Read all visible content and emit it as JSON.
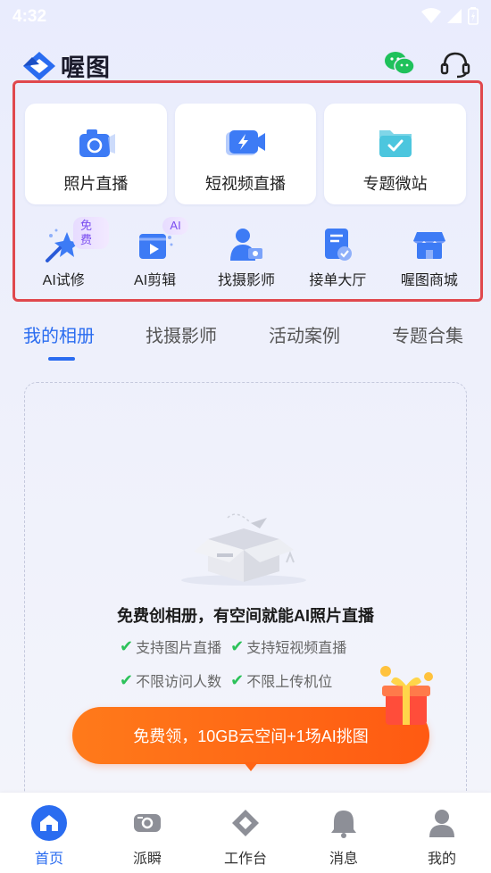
{
  "status_bar": {
    "time": "4:32"
  },
  "header": {
    "logo_text": "喔图"
  },
  "feature_cards": [
    {
      "label": "照片直播",
      "icon": "camera-icon"
    },
    {
      "label": "短视频直播",
      "icon": "video-camera-icon"
    },
    {
      "label": "专题微站",
      "icon": "folder-check-icon"
    }
  ],
  "tools": [
    {
      "label": "AI试修",
      "icon": "magic-star-icon",
      "badge": "免费"
    },
    {
      "label": "AI剪辑",
      "icon": "video-edit-icon",
      "badge": "AI"
    },
    {
      "label": "找摄影师",
      "icon": "photographer-icon",
      "badge": ""
    },
    {
      "label": "接单大厅",
      "icon": "order-document-icon",
      "badge": ""
    },
    {
      "label": "喔图商城",
      "icon": "store-icon",
      "badge": ""
    }
  ],
  "tabs": [
    {
      "label": "我的相册",
      "active": true
    },
    {
      "label": "找摄影师",
      "active": false
    },
    {
      "label": "活动案例",
      "active": false
    },
    {
      "label": "专题合集",
      "active": false
    }
  ],
  "empty_state": {
    "title": "免费创相册，有空间就能AI照片直播",
    "features": [
      "支持图片直播",
      "支持短视频直播",
      "不限访问人数",
      "不限上传机位"
    ],
    "promo": "免费领，10GB云空间+1场AI挑图"
  },
  "bottom_nav": [
    {
      "label": "首页",
      "icon": "home-icon",
      "active": true
    },
    {
      "label": "派瞬",
      "icon": "moments-icon",
      "active": false
    },
    {
      "label": "工作台",
      "icon": "workbench-icon",
      "active": false
    },
    {
      "label": "消息",
      "icon": "bell-icon",
      "active": false
    },
    {
      "label": "我的",
      "icon": "user-icon",
      "active": false
    }
  ],
  "colors": {
    "accent": "#2a6cf0",
    "highlight_border": "#e0484d",
    "promo": "#ff6a14",
    "check": "#2cc25a"
  }
}
